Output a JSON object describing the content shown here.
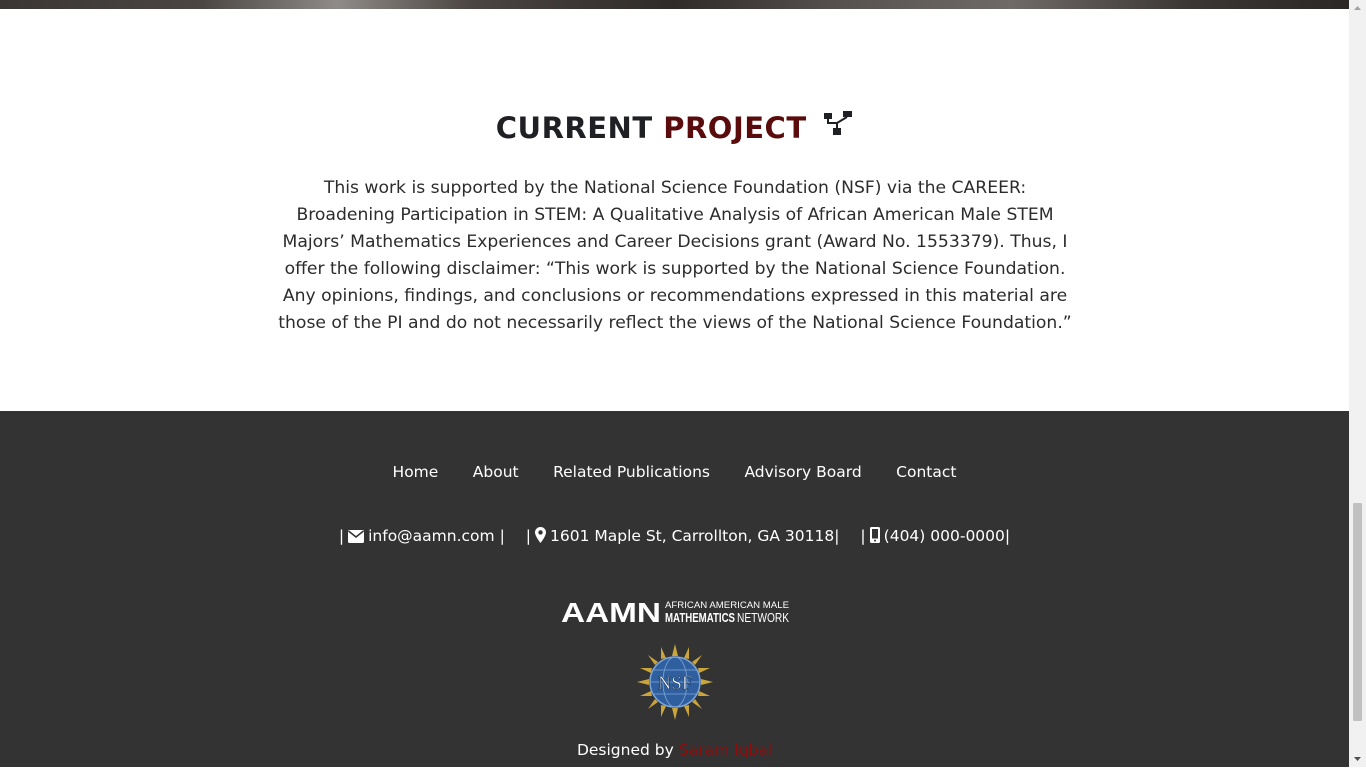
{
  "project": {
    "title_part1": "CURRENT",
    "title_part2": "PROJECT",
    "title_icon": "sitemap-icon",
    "body": "This work is supported by the National Science Foundation (NSF) via the CAREER: Broadening Participation in STEM: A Qualitative Analysis of African American Male STEM Majors’ Mathematics Experiences and Career Decisions grant (Award No. 1553379). Thus, I offer the following disclaimer: “This work is supported by the National Science Foundation. Any opinions, findings, and conclusions or recommendations expressed in this material are those of the PI and do not necessarily reflect the views of the National Science Foundation.”"
  },
  "footer": {
    "nav": [
      "Home",
      "About",
      "Related Publications",
      "Advisory Board",
      "Contact"
    ],
    "contact": {
      "email": "info@aamn.com",
      "email_icon": "envelope-icon",
      "address": "1601 Maple St, Carrollton, GA 30118",
      "address_icon": "map-marker-icon",
      "phone": "(404) 000-0000",
      "phone_icon": "mobile-phone-icon",
      "separator": "|"
    },
    "logo": {
      "mark": "AAMN",
      "line1": "AFRICAN AMERICAN MALE",
      "line2_bold": "MATHEMATICS",
      "line2_light": "NETWORK"
    },
    "nsf_logo": {
      "text": "NSF"
    },
    "designed_by": "Designed by",
    "designer": "Saram Iqbal"
  },
  "colors": {
    "accent_red": "#5a0b0b",
    "designer_red": "#8e0d0d",
    "footer_bg": "#333333",
    "title_dark": "#1f2024"
  }
}
